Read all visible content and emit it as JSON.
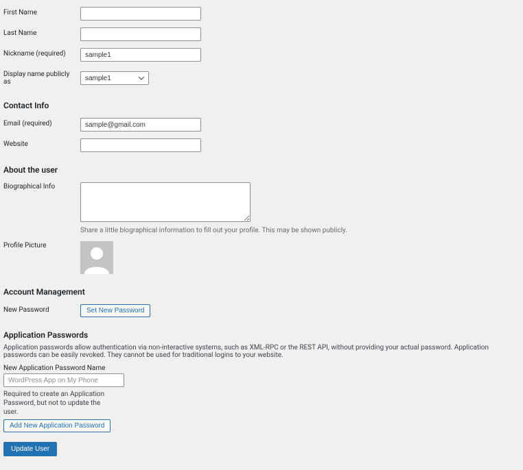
{
  "fields": {
    "first_name": {
      "label": "First Name",
      "value": ""
    },
    "last_name": {
      "label": "Last Name",
      "value": ""
    },
    "nickname": {
      "label": "Nickname (required)",
      "value": "sample1"
    },
    "display_name": {
      "label": "Display name publicly as",
      "value": "sample1"
    },
    "email": {
      "label": "Email (required)",
      "value": "sample@gmail.com"
    },
    "website": {
      "label": "Website",
      "value": ""
    },
    "bio": {
      "label": "Biographical Info",
      "value": "",
      "help": "Share a little biographical information to fill out your profile. This may be shown publicly."
    },
    "profile_picture": {
      "label": "Profile Picture"
    },
    "new_password": {
      "label": "New Password",
      "button": "Set New Password"
    }
  },
  "sections": {
    "contact_info": "Contact Info",
    "about_user": "About the user",
    "account_mgmt": "Account Management",
    "app_passwords": "Application Passwords"
  },
  "app_passwords": {
    "intro": "Application passwords allow authentication via non-interactive systems, such as XML-RPC or the REST API, without providing your actual password. Application passwords can be easily revoked. They cannot be used for traditional logins to your website.",
    "new_label": "New Application Password Name",
    "placeholder": "WordPress App on My Phone",
    "help": "Required to create an Application Password, but not to update the user.",
    "add_button": "Add New Application Password"
  },
  "submit": {
    "label": "Update User"
  }
}
